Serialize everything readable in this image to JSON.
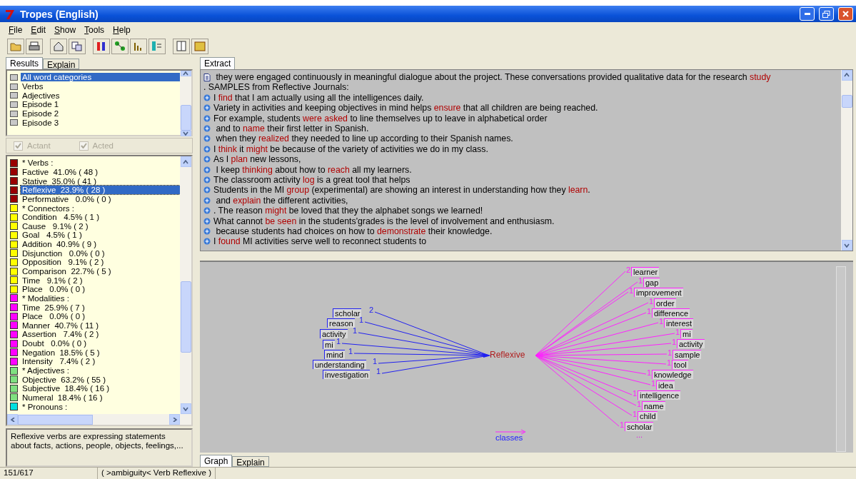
{
  "window": {
    "title": "Tropes (English)"
  },
  "menu": [
    "File",
    "Edit",
    "Show",
    "Tools",
    "Help"
  ],
  "left_tabs": [
    {
      "label": "Results",
      "selected": true
    },
    {
      "label": "Explain",
      "selected": false
    }
  ],
  "word_sets": [
    {
      "label": "All word categories",
      "selected": true
    },
    {
      "label": "Verbs",
      "selected": false
    },
    {
      "label": "Adjectives",
      "selected": false
    },
    {
      "label": "Episode 1",
      "selected": false
    },
    {
      "label": "Episode 2",
      "selected": false
    },
    {
      "label": "Episode 3",
      "selected": false
    }
  ],
  "filters": [
    {
      "label": "Actant",
      "checked": true,
      "disabled": true
    },
    {
      "label": "Acted",
      "checked": true,
      "disabled": true
    }
  ],
  "categories": [
    {
      "label": "* Verbs :",
      "color": "#990000",
      "selected": false
    },
    {
      "label": "Factive  41.0% ( 48 )",
      "color": "#990000",
      "selected": false
    },
    {
      "label": "Stative  35.0% ( 41 )",
      "color": "#990000",
      "selected": false
    },
    {
      "label": "Reflexive  23.9% ( 28 )",
      "color": "#990000",
      "selected": true
    },
    {
      "label": "Performative   0.0% ( 0 )",
      "color": "#990000",
      "selected": false
    },
    {
      "label": "* Connectors :",
      "color": "#ffff00",
      "selected": false
    },
    {
      "label": "Condition   4.5% ( 1 )",
      "color": "#ffff00",
      "selected": false
    },
    {
      "label": "Cause   9.1% ( 2 )",
      "color": "#ffff00",
      "selected": false
    },
    {
      "label": "Goal   4.5% ( 1 )",
      "color": "#ffff00",
      "selected": false
    },
    {
      "label": "Addition  40.9% ( 9 )",
      "color": "#ffff00",
      "selected": false
    },
    {
      "label": "Disjunction   0.0% ( 0 )",
      "color": "#ffff00",
      "selected": false
    },
    {
      "label": "Opposition   9.1% ( 2 )",
      "color": "#ffff00",
      "selected": false
    },
    {
      "label": "Comparison  22.7% ( 5 )",
      "color": "#ffff00",
      "selected": false
    },
    {
      "label": "Time   9.1% ( 2 )",
      "color": "#ffff00",
      "selected": false
    },
    {
      "label": "Place   0.0% ( 0 )",
      "color": "#ffff00",
      "selected": false
    },
    {
      "label": "* Modalities :",
      "color": "#ff00ff",
      "selected": false
    },
    {
      "label": "Time  25.9% ( 7 )",
      "color": "#ff00ff",
      "selected": false
    },
    {
      "label": "Place   0.0% ( 0 )",
      "color": "#ff00ff",
      "selected": false
    },
    {
      "label": "Manner  40.7% ( 11 )",
      "color": "#ff00ff",
      "selected": false
    },
    {
      "label": "Assertion   7.4% ( 2 )",
      "color": "#ff00ff",
      "selected": false
    },
    {
      "label": "Doubt   0.0% ( 0 )",
      "color": "#ff00ff",
      "selected": false
    },
    {
      "label": "Negation  18.5% ( 5 )",
      "color": "#ff00ff",
      "selected": false
    },
    {
      "label": "Intensity   7.4% ( 2 )",
      "color": "#ff00ff",
      "selected": false
    },
    {
      "label": "* Adjectives :",
      "color": "#80e080",
      "selected": false
    },
    {
      "label": "Objective  63.2% ( 55 )",
      "color": "#80e080",
      "selected": false
    },
    {
      "label": "Subjective  18.4% ( 16 )",
      "color": "#80e080",
      "selected": false
    },
    {
      "label": "Numeral  18.4% ( 16 )",
      "color": "#80e080",
      "selected": false
    },
    {
      "label": "* Pronouns :",
      "color": "#00e0e0",
      "selected": false
    }
  ],
  "description": "Reflexive verbs are expressing statements about facts, actions, people, objects, feelings,...",
  "right_tabs": [
    {
      "label": "Extract",
      "selected": true
    }
  ],
  "extract": [
    {
      "kind": "document",
      "parts": [
        {
          "text": " they were engaged continuously in meaningful dialogue about the project. These conversations provided qualitative data for the research ",
          "term": false
        },
        {
          "text": "study",
          "term": true
        }
      ]
    },
    {
      "kind": "continuation",
      "parts": [
        {
          "text": ". SAMPLES from Reflective Journals:",
          "term": false
        }
      ]
    },
    {
      "kind": "bullet",
      "parts": [
        {
          "text": "I ",
          "term": false
        },
        {
          "text": "find",
          "term": true
        },
        {
          "text": " that I am actually using all the intelligences daily.",
          "term": false
        }
      ]
    },
    {
      "kind": "bullet",
      "parts": [
        {
          "text": "Variety in activities and keeping objectives in mind helps ",
          "term": false
        },
        {
          "text": "ensure",
          "term": true
        },
        {
          "text": " that all children are being reached.",
          "term": false
        }
      ]
    },
    {
      "kind": "bullet",
      "parts": [
        {
          "text": "For example, students ",
          "term": false
        },
        {
          "text": "were asked",
          "term": true
        },
        {
          "text": " to line themselves up to leave in alphabetical order",
          "term": false
        }
      ]
    },
    {
      "kind": "bullet",
      "parts": [
        {
          "text": " and to ",
          "term": false
        },
        {
          "text": "name",
          "term": true
        },
        {
          "text": " their first letter in Spanish.",
          "term": false
        }
      ]
    },
    {
      "kind": "bullet",
      "parts": [
        {
          "text": " when they ",
          "term": false
        },
        {
          "text": "realized",
          "term": true
        },
        {
          "text": " they needed to line up according to their Spanish names.",
          "term": false
        }
      ]
    },
    {
      "kind": "bullet",
      "parts": [
        {
          "text": "I ",
          "term": false
        },
        {
          "text": "think",
          "term": true
        },
        {
          "text": " it ",
          "term": false
        },
        {
          "text": "might",
          "term": true
        },
        {
          "text": " be because of the variety of activities we do in my class.",
          "term": false
        }
      ]
    },
    {
      "kind": "bullet",
      "parts": [
        {
          "text": "As I ",
          "term": false
        },
        {
          "text": "plan",
          "term": true
        },
        {
          "text": " new lessons,",
          "term": false
        }
      ]
    },
    {
      "kind": "bullet",
      "parts": [
        {
          "text": " I keep ",
          "term": false
        },
        {
          "text": "thinking",
          "term": true
        },
        {
          "text": " about how to ",
          "term": false
        },
        {
          "text": "reach",
          "term": true
        },
        {
          "text": " all my learners.",
          "term": false
        }
      ]
    },
    {
      "kind": "bullet",
      "parts": [
        {
          "text": "The classroom activity ",
          "term": false
        },
        {
          "text": "log",
          "term": true
        },
        {
          "text": " is a great tool that helps",
          "term": false
        }
      ]
    },
    {
      "kind": "bullet",
      "parts": [
        {
          "text": "Students in the MI ",
          "term": false
        },
        {
          "text": "group",
          "term": true
        },
        {
          "text": " (experimental) are showing an interest in understanding how they ",
          "term": false
        },
        {
          "text": "learn",
          "term": true
        },
        {
          "text": ".",
          "term": false
        }
      ]
    },
    {
      "kind": "bullet",
      "parts": [
        {
          "text": " and ",
          "term": false
        },
        {
          "text": "explain",
          "term": true
        },
        {
          "text": " the different activities,",
          "term": false
        }
      ]
    },
    {
      "kind": "bullet",
      "parts": [
        {
          "text": ". The reason ",
          "term": false
        },
        {
          "text": "might",
          "term": true
        },
        {
          "text": " be loved that they the alphabet songs we learned!",
          "term": false
        }
      ]
    },
    {
      "kind": "bullet",
      "parts": [
        {
          "text": "What cannot ",
          "term": false
        },
        {
          "text": "be seen",
          "term": true
        },
        {
          "text": " in the students'grades is the level of involvement and enthusiasm.",
          "term": false
        }
      ]
    },
    {
      "kind": "bullet",
      "parts": [
        {
          "text": " because students had choices on how to ",
          "term": false
        },
        {
          "text": "demonstrate",
          "term": true
        },
        {
          "text": " their knowledge.",
          "term": false
        }
      ]
    },
    {
      "kind": "bullet",
      "parts": [
        {
          "text": "I ",
          "term": false
        },
        {
          "text": "found",
          "term": true
        },
        {
          "text": " MI activities serve well to reconnect students to",
          "term": false
        }
      ]
    }
  ],
  "graph": {
    "center": "Reflexive",
    "left": [
      {
        "label": "scholar",
        "count": "2"
      },
      {
        "label": "reason",
        "count": "1"
      },
      {
        "label": "activity",
        "count": "1"
      },
      {
        "label": "mi",
        "count": "1"
      },
      {
        "label": "mind",
        "count": "1"
      },
      {
        "label": "understanding",
        "count": "1"
      },
      {
        "label": "investigation",
        "count": "1"
      }
    ],
    "right": [
      {
        "label": "learner",
        "count": "2"
      },
      {
        "label": "gap",
        "count": "1"
      },
      {
        "label": "improvement",
        "count": "1"
      },
      {
        "label": "order",
        "count": "1"
      },
      {
        "label": "difference",
        "count": "1"
      },
      {
        "label": "interest",
        "count": "1"
      },
      {
        "label": "mi",
        "count": "1"
      },
      {
        "label": "activity",
        "count": "1"
      },
      {
        "label": "sample",
        "count": "1"
      },
      {
        "label": "tool",
        "count": "1"
      },
      {
        "label": "knowledge",
        "count": "1"
      },
      {
        "label": "idea",
        "count": "1"
      },
      {
        "label": "intelligence",
        "count": "1"
      },
      {
        "label": "name",
        "count": "1"
      },
      {
        "label": "child",
        "count": "1"
      },
      {
        "label": "scholar",
        "count": "1"
      }
    ],
    "more": "...",
    "legend": "classes"
  },
  "graph_tabs": [
    {
      "label": "Graph",
      "selected": true
    },
    {
      "label": "Explain",
      "selected": false
    }
  ],
  "status_bar": [
    "151/617",
    "( >ambiguity< Verb Reflexive )"
  ]
}
